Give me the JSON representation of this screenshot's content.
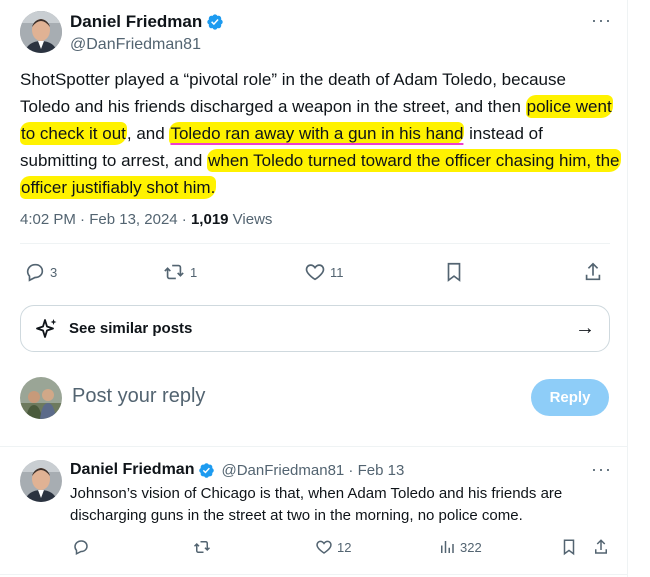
{
  "main_tweet": {
    "author_name": "Daniel Friedman",
    "handle": "@DanFriedman81",
    "more_label": "···",
    "text_1": "ShotSpotter played a “pivotal role” in the death of Adam Toledo, because Toledo and his friends discharged a weapon in the street, and then ",
    "text_hl_1": "police went to check it out",
    "text_2": ", and ",
    "text_hl_2": "Toledo ran away with a gun in his hand",
    "text_3": " instead of submitting to arrest, and ",
    "text_hl_3": "when Toledo turned toward the officer chasing him, the officer justifiably shot him.",
    "time": "4:02 PM",
    "sep1": " · ",
    "date": "Feb 13, 2024",
    "sep2": " · ",
    "views_count": "1,019",
    "views_label": " Views",
    "replies": "3",
    "reposts": "1",
    "likes": "11"
  },
  "similar_posts": {
    "label": "See similar posts",
    "arrow": "→"
  },
  "reply_box": {
    "placeholder": "Post your reply",
    "button": "Reply"
  },
  "reply_tweet": {
    "author_name": "Daniel Friedman",
    "handle_date": "@DanFriedman81 · Feb 13",
    "more_label": "···",
    "text": "Johnson’s vision of Chicago is that, when Adam Toledo and his friends are discharging guns in the street at two in the morning, no police come.",
    "likes": "12",
    "views": "322"
  },
  "colors": {
    "highlight": "#fff200",
    "underline": "#ee3fcf",
    "verified": "#1d9bf0",
    "reply_button": "#8ecdf8"
  }
}
